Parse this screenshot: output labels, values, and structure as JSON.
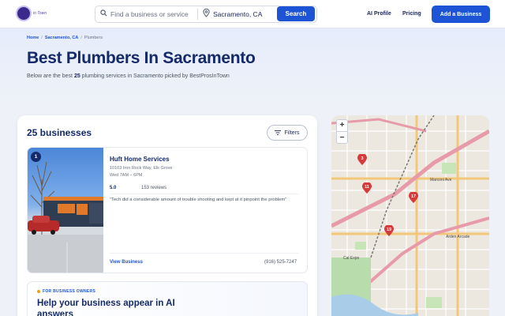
{
  "header": {
    "logo_text": "in Town",
    "search_placeholder": "Find a business or service",
    "location_value": "Sacramento, CA",
    "search_button": "Search",
    "nav": [
      "AI Profile",
      "Pricing"
    ],
    "add_button": "Add a Business"
  },
  "breadcrumb": {
    "items": [
      "Home",
      "Sacramento, CA"
    ],
    "current": "Plumbers"
  },
  "hero": {
    "title": "Best Plumbers In Sacramento",
    "subtitle_pre": "Below are the best ",
    "subtitle_count": "25",
    "subtitle_post": " plumbing services in Sacramento picked by BestProsInTown"
  },
  "results": {
    "count_label": "25 businesses",
    "filters_label": "Filters"
  },
  "listings": [
    {
      "rank": "1",
      "name": "Huft Home Services",
      "address": "10103 Iron Rock Way, Elk Grove",
      "hours": "Wed 7AM – 6PM",
      "rating": "5.0",
      "reviews": "153 reviews",
      "quote": "\"Tech did a considerable amount of trouble shooting and kept at it pinpoint the problem\"",
      "view_label": "View Business",
      "phone": "(916) 525-7247"
    }
  ],
  "owners": {
    "tag": "FOR BUSINESS OWNERS",
    "title": "Help your business appear in AI answers"
  },
  "map": {
    "zoom_in": "+",
    "zoom_out": "−",
    "markers": [
      "3",
      "11",
      "17",
      "19"
    ],
    "labels": [
      "Arden Arcade",
      "Cal Expo",
      "Marconi Ave"
    ]
  },
  "colors": {
    "primary": "#1d54d6",
    "heading": "#142a6a",
    "marker": "#d63a3a"
  }
}
